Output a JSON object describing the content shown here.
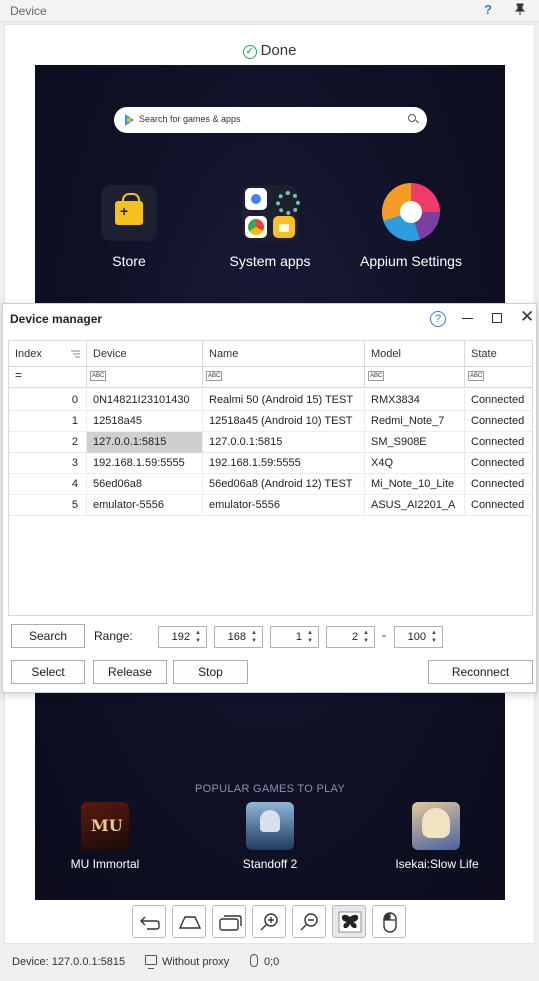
{
  "panel": {
    "title": "Device",
    "help": "?",
    "pin": "📌",
    "status_done": "Done"
  },
  "screen": {
    "search_placeholder": "Search for games & apps",
    "apps": [
      {
        "label": "Store",
        "icon": "play-store-icon"
      },
      {
        "label": "System apps",
        "icon": "system-apps-folder-icon"
      },
      {
        "label": "Appium Settings",
        "icon": "appium-settings-icon"
      }
    ],
    "popular_title": "POPULAR GAMES TO PLAY",
    "games": [
      {
        "label": "MU Immortal",
        "icon": "mu-immortal-icon"
      },
      {
        "label": "Standoff 2",
        "icon": "standoff-2-icon"
      },
      {
        "label": "Isekai:Slow Life",
        "icon": "isekai-slow-life-icon"
      }
    ]
  },
  "controls": [
    {
      "name": "back-button",
      "icon": "back-arrow-icon"
    },
    {
      "name": "home-button",
      "icon": "home-icon"
    },
    {
      "name": "recents-button",
      "icon": "recent-apps-icon"
    },
    {
      "name": "zoom-in-button",
      "icon": "zoom-in-icon"
    },
    {
      "name": "zoom-out-button",
      "icon": "zoom-out-icon"
    },
    {
      "name": "screenshot-button",
      "icon": "butterfly-icon"
    },
    {
      "name": "mouse-button",
      "icon": "mouse-icon"
    }
  ],
  "status": {
    "device": "Device: 127.0.0.1:5815",
    "proxy": "Without proxy",
    "coords": "0;0"
  },
  "device_manager": {
    "title": "Device manager",
    "help": "?",
    "columns": [
      "Index",
      "Device",
      "Name",
      "Model",
      "State"
    ],
    "filter_equals": "=",
    "filter_abc": "ABC",
    "rows": [
      {
        "index": "0",
        "device": "0N14821I23101430",
        "name": "Realmi 50 (Android 15) TEST",
        "model": "RMX3834",
        "state": "Connected"
      },
      {
        "index": "1",
        "device": "12518a45",
        "name": "12518a45 (Android 10) TEST",
        "model": "Redmi_Note_7",
        "state": "Connected"
      },
      {
        "index": "2",
        "device": "127.0.0.1:5815",
        "name": "127.0.0.1:5815",
        "model": "SM_S908E",
        "state": "Connected"
      },
      {
        "index": "3",
        "device": "192.168.1.59:5555",
        "name": "192.168.1.59:5555",
        "model": "X4Q",
        "state": "Connected"
      },
      {
        "index": "4",
        "device": "56ed06a8",
        "name": "56ed06a8 (Android 12) TEST",
        "model": "Mi_Note_10_Lite",
        "state": "Connected"
      },
      {
        "index": "5",
        "device": "emulator-5556",
        "name": "emulator-5556",
        "model": "ASUS_AI2201_A",
        "state": "Connected"
      }
    ],
    "search_label": "Search",
    "range_label": "Range:",
    "range": [
      "192",
      "168",
      "1",
      "2",
      "100"
    ],
    "range_dash": "-",
    "select_label": "Select",
    "release_label": "Release",
    "stop_label": "Stop",
    "reconnect_label": "Reconnect"
  }
}
